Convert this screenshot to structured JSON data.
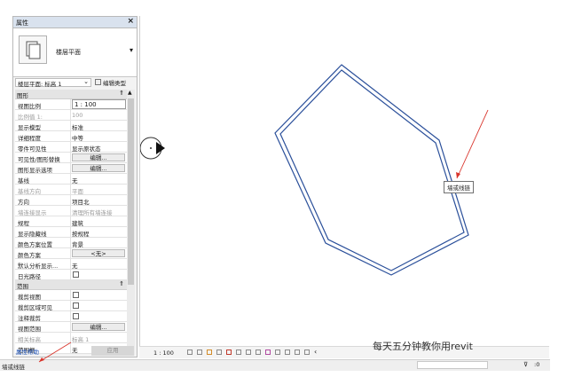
{
  "palette": {
    "title": "属性",
    "close_label": "×",
    "type_name": "楼层平面",
    "instance_selector": "楼层平面: 标高 1",
    "edit_type_label": "编辑类型",
    "sections": {
      "graphics": "图形",
      "extents": "范围"
    },
    "graphics_rows": [
      {
        "key": "视图比例",
        "value": "1 : 100"
      },
      {
        "key": "比例值 1:",
        "value": "100"
      },
      {
        "key": "显示模型",
        "value": "标准"
      },
      {
        "key": "详细程度",
        "value": "中等"
      },
      {
        "key": "零件可见性",
        "value": "显示原状态"
      },
      {
        "key": "可见性/图形替换",
        "value": "编辑..."
      },
      {
        "key": "图形显示选项",
        "value": "编辑..."
      },
      {
        "key": "基线",
        "value": "无"
      },
      {
        "key": "基线方向",
        "value": "平面"
      },
      {
        "key": "方向",
        "value": "项目北"
      },
      {
        "key": "墙连接显示",
        "value": "清理所有墙连接"
      },
      {
        "key": "规程",
        "value": "建筑"
      },
      {
        "key": "显示隐藏线",
        "value": "按规程"
      },
      {
        "key": "颜色方案位置",
        "value": "背景"
      },
      {
        "key": "颜色方案",
        "value": "<无>"
      },
      {
        "key": "默认分析显示...",
        "value": "无"
      },
      {
        "key": "日光路径",
        "value": ""
      }
    ],
    "extents_rows": [
      {
        "key": "裁剪视图",
        "value": ""
      },
      {
        "key": "裁剪区域可见",
        "value": ""
      },
      {
        "key": "注释裁剪",
        "value": ""
      },
      {
        "key": "视图范围",
        "value": "编辑..."
      },
      {
        "key": "相关标高",
        "value": "标高 1"
      },
      {
        "key": "范围框",
        "value": "无"
      }
    ],
    "help_link": "属性帮助",
    "apply_label": "应用"
  },
  "view": {
    "scale_label": "1 : 100",
    "tooltip": "墙或线链"
  },
  "status_bar": {
    "text": "墙或线链",
    "zero_label": ":0"
  },
  "watermark": "每天五分钟教你用revit",
  "colors": {
    "wall_line": "#2a4f9a",
    "arrow": "#d9342b"
  }
}
